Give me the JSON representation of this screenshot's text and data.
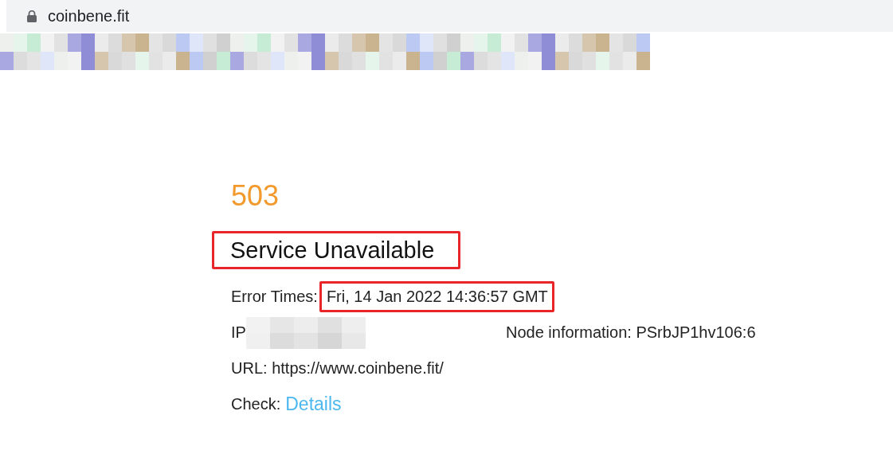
{
  "address_bar": {
    "url": "coinbene.fit"
  },
  "error": {
    "code": "503",
    "title": "Service Unavailable",
    "title_highlighted": true
  },
  "error_time": {
    "label": "Error Times:",
    "value": "Fri, 14 Jan 2022 14:36:57 GMT",
    "highlighted": true
  },
  "ip": {
    "label": "IP"
  },
  "node": {
    "label": "Node information:",
    "value": "PSrbJP1hv106:6"
  },
  "url": {
    "label": "URL:",
    "value": "https://www.coinbene.fit/"
  },
  "check": {
    "label": "Check:",
    "link": "Details"
  }
}
